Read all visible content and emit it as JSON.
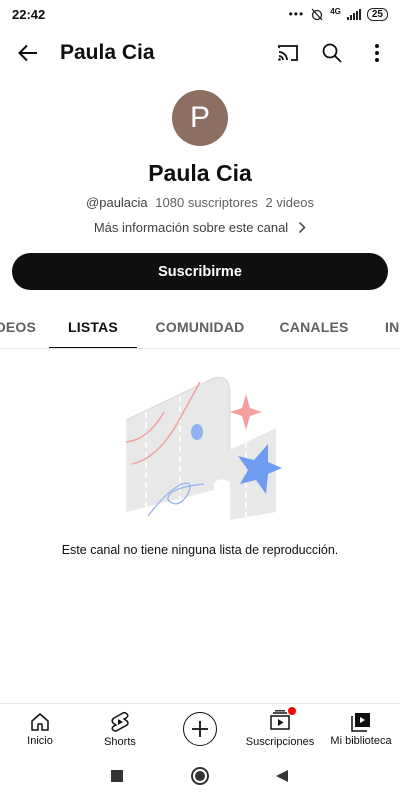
{
  "status_bar": {
    "time": "22:42",
    "dots": "•••",
    "network": "4G",
    "battery": "25"
  },
  "app_bar": {
    "title": "Paula Cia",
    "icons": [
      "back-arrow-icon",
      "cast-icon",
      "search-icon",
      "more-vert-icon"
    ]
  },
  "channel": {
    "avatar_letter": "P",
    "avatar_color": "#8d6e63",
    "name": "Paula Cia",
    "handle": "@paulacia",
    "subscribers": "1080 suscriptores",
    "videos": "2 videos",
    "more_info": "Más información sobre este canal",
    "subscribe_label": "Suscribirme"
  },
  "tabs": [
    {
      "label": "VIDEOS",
      "active": false
    },
    {
      "label": "LISTAS",
      "active": true
    },
    {
      "label": "COMUNIDAD",
      "active": false
    },
    {
      "label": "CANALES",
      "active": false
    },
    {
      "label": "INFORMACIÓN",
      "active": false
    }
  ],
  "empty_state": {
    "message": "Este canal no tiene ninguna lista de reproducción."
  },
  "bottom_nav": [
    {
      "label": "Inicio",
      "icon": "home-icon"
    },
    {
      "label": "Shorts",
      "icon": "shorts-icon"
    },
    {
      "label": "",
      "icon": "create-icon"
    },
    {
      "label": "Suscripciones",
      "icon": "subscriptions-icon",
      "badge": true
    },
    {
      "label": "Mi biblioteca",
      "icon": "library-icon"
    }
  ],
  "colors": {
    "accent": "#0f0f0f",
    "notification_dot": "#ff0000"
  }
}
